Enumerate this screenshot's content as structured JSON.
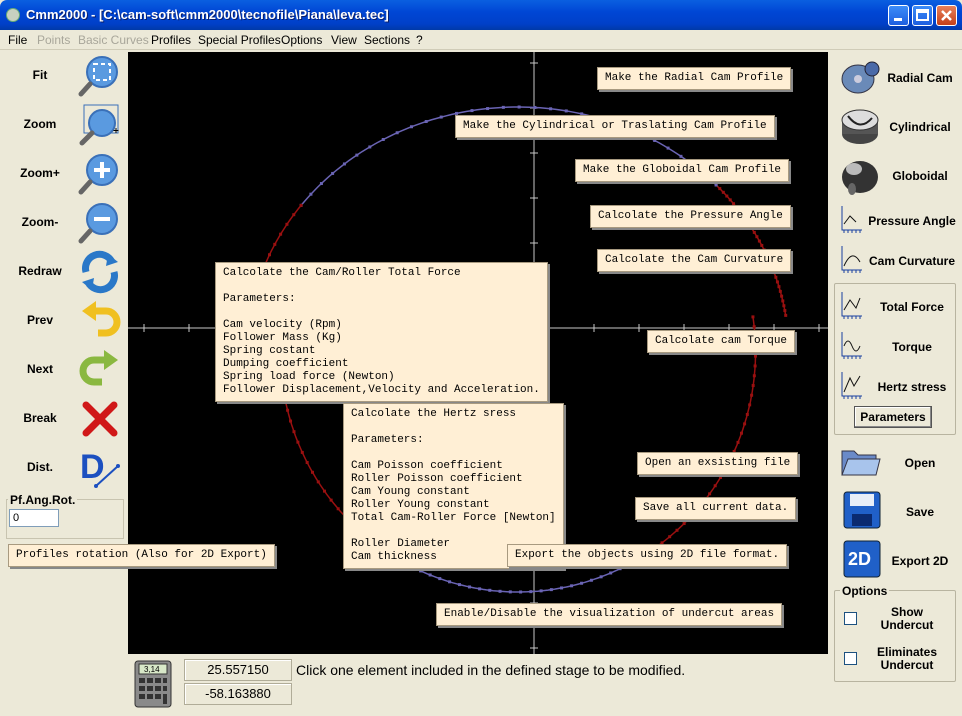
{
  "window": {
    "title": "Cmm2000 - [C:\\cam-soft\\cmm2000\\tecnofile\\Piana\\leva.tec]"
  },
  "menu": [
    "File",
    "Points",
    "Basic Curves",
    "Profiles",
    "Special Profiles",
    "Options",
    "View",
    "Sections",
    "?"
  ],
  "menu_disabled": [
    "Points",
    "Basic Curves"
  ],
  "left_tools": [
    {
      "label": "Fit",
      "icon": "fit-magnifier-icon"
    },
    {
      "label": "Zoom",
      "icon": "zoom-window-icon"
    },
    {
      "label": "Zoom+",
      "icon": "zoom-in-icon"
    },
    {
      "label": "Zoom-",
      "icon": "zoom-out-icon"
    },
    {
      "label": "Redraw",
      "icon": "redraw-icon"
    },
    {
      "label": "Prev",
      "icon": "undo-arrow-icon"
    },
    {
      "label": "Next",
      "icon": "redo-arrow-icon"
    },
    {
      "label": "Break",
      "icon": "break-x-icon"
    },
    {
      "label": "Dist.",
      "icon": "distance-icon"
    }
  ],
  "rotation": {
    "group_label": "Pf.Ang.Rot.",
    "value": "0"
  },
  "tooltips": {
    "radial": "Make the Radial Cam Profile",
    "cylindrical": "Make the Cylindrical or Traslating Cam Profile",
    "globoidal": "Make the Globoidal Cam Profile",
    "pressure": "Calcolate the Pressure Angle",
    "curvature": "Calcolate the Cam Curvature",
    "torque": "Calcolate cam Torque",
    "total_force": "Calcolate the Cam/Roller Total Force\n\nParameters:\n\nCam velocity (Rpm)\nFollower Mass (Kg)\nSpring costant\nDumping coefficient\nSpring load force (Newton)\nFollower Displacement,Velocity and Acceleration.",
    "hertz": "Calcolate the Hertz sress\n\nParameters:\n\nCam Poisson coefficient\nRoller Poisson coefficient\nCam Young constant\nRoller Young constant\nTotal Cam-Roller Force [Newton]\n\nRoller Diameter\nCam thickness",
    "open": "Open an exsisting file",
    "save": "Save all current data.",
    "export": "Export the objects using 2D file format.",
    "rotation": "Profiles rotation (Also for 2D Export)",
    "undercut": "Enable/Disable the visualization of undercut areas"
  },
  "right_buttons": {
    "radial": "Radial Cam",
    "cylindrical": "Cylindrical",
    "globoidal": "Globoidal",
    "pressure": "Pressure Angle",
    "curvature": "Cam Curvature",
    "total_force": "Total Force",
    "torque": "Torque",
    "hertz": "Hertz stress",
    "parameters": "Parameters",
    "open": "Open",
    "save": "Save",
    "export": "Export 2D"
  },
  "options": {
    "label": "Options",
    "show_undercut": "Show\nUndercut",
    "eliminate_undercut": "Eliminates\nUndercut"
  },
  "status": {
    "x": "25.557150",
    "y": "-58.163880",
    "message": "Click one element included in the defined stage to be modified.",
    "calc_label": "3,14"
  },
  "colors": {
    "profile_blue": "#6a64b4",
    "profile_red": "#9a1010",
    "axis": "#c8c8c8",
    "background": "#000000"
  }
}
